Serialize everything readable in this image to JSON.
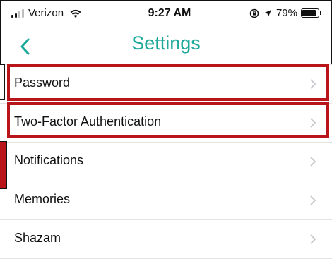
{
  "status_bar": {
    "carrier": "Verizon",
    "time": "9:27 AM",
    "battery_percent": "79%",
    "battery_level": 0.79,
    "icons": [
      "signal-icon",
      "wifi-icon",
      "rotation-lock-icon",
      "location-icon",
      "battery-icon"
    ]
  },
  "nav": {
    "title": "Settings",
    "back_icon": "chevron-left-icon"
  },
  "settings": {
    "items": [
      {
        "label": "Password",
        "highlighted": true
      },
      {
        "label": "Two-Factor Authentication",
        "highlighted": true
      },
      {
        "label": "Notifications",
        "highlighted": false
      },
      {
        "label": "Memories",
        "highlighted": false
      },
      {
        "label": "Shazam",
        "highlighted": false
      }
    ]
  },
  "colors": {
    "accent": "#1aa898",
    "highlight": "#b8141a",
    "divider": "#e4e4e4",
    "chevron": "#c7c7cc"
  }
}
